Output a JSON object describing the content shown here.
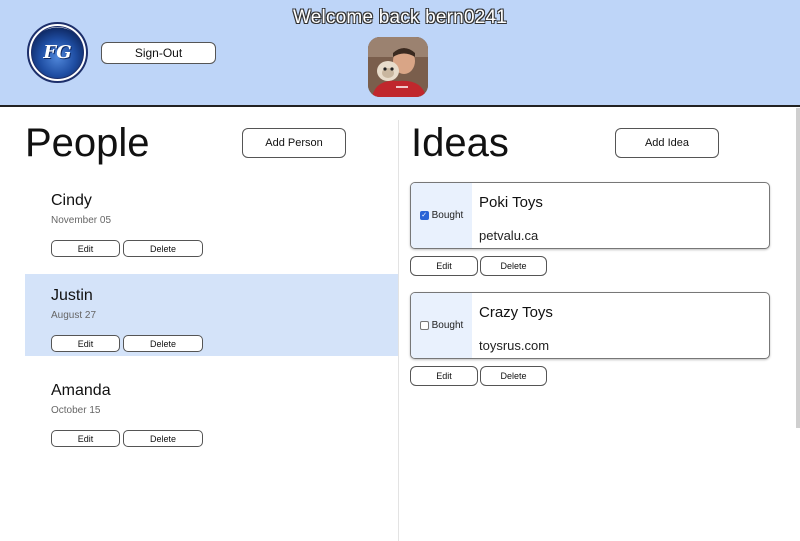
{
  "header": {
    "welcome": "Welcome back bern0241",
    "logo_text": "FG",
    "signout_label": "Sign-Out"
  },
  "people": {
    "title": "People",
    "add_label": "Add Person",
    "items": [
      {
        "name": "Cindy",
        "date": "November 05",
        "edit_label": "Edit",
        "delete_label": "Delete",
        "selected": false
      },
      {
        "name": "Justin",
        "date": "August 27",
        "edit_label": "Edit",
        "delete_label": "Delete",
        "selected": true
      },
      {
        "name": "Amanda",
        "date": "October 15",
        "edit_label": "Edit",
        "delete_label": "Delete",
        "selected": false
      }
    ]
  },
  "ideas": {
    "title": "Ideas",
    "add_label": "Add Idea",
    "items": [
      {
        "title": "Poki Toys",
        "store": "petvalu.ca",
        "bought_label": "Bought",
        "bought": true,
        "edit_label": "Edit",
        "delete_label": "Delete"
      },
      {
        "title": "Crazy Toys",
        "store": "toysrus.com",
        "bought_label": "Bought",
        "bought": false,
        "edit_label": "Edit",
        "delete_label": "Delete"
      }
    ]
  },
  "colors": {
    "header_bg": "#bed5f8",
    "selected_row": "#d4e3f9",
    "checkbox_checked": "#2a64d6"
  },
  "icons": [
    "app-logo-icon",
    "user-avatar"
  ]
}
